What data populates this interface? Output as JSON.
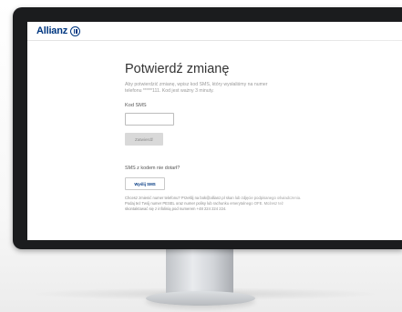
{
  "header": {
    "logo_text": "Allianz",
    "logo_icon": "allianz-eagle-icon"
  },
  "main": {
    "title": "Potwierdź zmianę",
    "description": "Aby potwierdzić zmianę, wpisz kod SMS, który wysłaliśmy na numer telefonu *****111. Kod jest ważny 3 minuty.",
    "sms_label": "Kod SMS",
    "sms_value": "",
    "confirm_label": "Zatwierdź",
    "not_received_text": "SMS z kodem nie dotarł?",
    "resend_label": "Wyślij SMS",
    "help_text": "Chcesz zmienić numer telefonu? Prześlij na bok@allianz.pl skan lub zdjęcie podpisanego oświadczenia. Podaj też Twój numer PESEL oraz numer polisy lub rachunku emerytalnego OFE. Możesz też skontaktować się z infolinią pod numerem +48 224 224 224."
  },
  "colors": {
    "brand": "#003781",
    "button_disabled": "#d9d9d9",
    "bezel": "#1b1c1e"
  }
}
